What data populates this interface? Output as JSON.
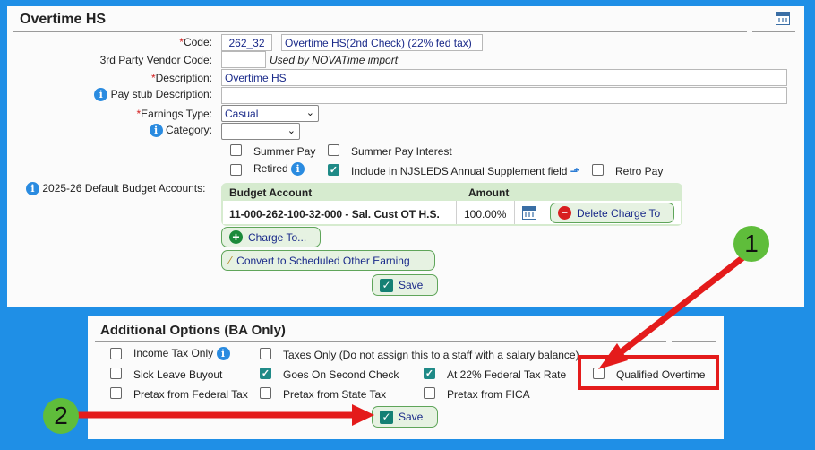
{
  "earning": {
    "title": "Overtime HS",
    "code_label": "Code:",
    "code_value": "262_32",
    "code_desc": "Overtime HS(2nd Check) (22% fed tax)",
    "vendor_label": "3rd Party Vendor Code:",
    "vendor_value": "",
    "vendor_note": "Used by NOVATime import",
    "desc_label": "Description:",
    "desc_value": "Overtime HS",
    "paystub_label": "Pay stub Description:",
    "paystub_value": "",
    "earn_type_label": "Earnings Type:",
    "earn_type_value": "Casual",
    "category_label": "Category:",
    "category_value": "",
    "opt_summer_pay": "Summer Pay",
    "opt_summer_pay_interest": "Summer Pay Interest",
    "opt_retired": "Retired",
    "opt_njsleds": "Include in NJSLEDS Annual Supplement field",
    "opt_retro_pay": "Retro Pay",
    "budget_label": "2025-26 Default Budget Accounts:",
    "budget_col_account": "Budget Account",
    "budget_col_amount": "Amount",
    "budget_rows": [
      {
        "account": "11-000-262-100-32-000 - Sal. Cust OT H.S.",
        "amount": "100.00%"
      }
    ],
    "delete_charge_label": "Delete Charge To",
    "charge_to_label": "Charge To...",
    "convert_label": "Convert to Scheduled Other Earning",
    "save_label": "Save"
  },
  "additional": {
    "title": "Additional Options (BA Only)",
    "income_tax_only": "Income Tax Only",
    "taxes_only": "Taxes Only (Do not assign this to a staff with a salary balance)",
    "sick_leave_buyout": "Sick Leave Buyout",
    "goes_on_second_check": "Goes On Second Check",
    "at_22_fed": "At 22% Federal Tax Rate",
    "qualified_overtime": "Qualified Overtime",
    "pretax_federal": "Pretax from Federal Tax",
    "pretax_state": "Pretax from State Tax",
    "pretax_fica": "Pretax from FICA",
    "save_label": "Save"
  },
  "annotations": {
    "badge1": "1",
    "badge2": "2",
    "color_arrow": "#e41b1b",
    "color_badge": "#5fbd3b"
  },
  "checkbox_states": {
    "summer_pay": false,
    "summer_pay_interest": false,
    "retired": false,
    "njsleds": true,
    "retro_pay": false,
    "income_tax_only": false,
    "taxes_only": false,
    "sick_leave_buyout": false,
    "goes_on_second_check": true,
    "at_22_fed": true,
    "qualified_overtime": false,
    "pretax_federal": false,
    "pretax_state": false,
    "pretax_fica": false
  }
}
